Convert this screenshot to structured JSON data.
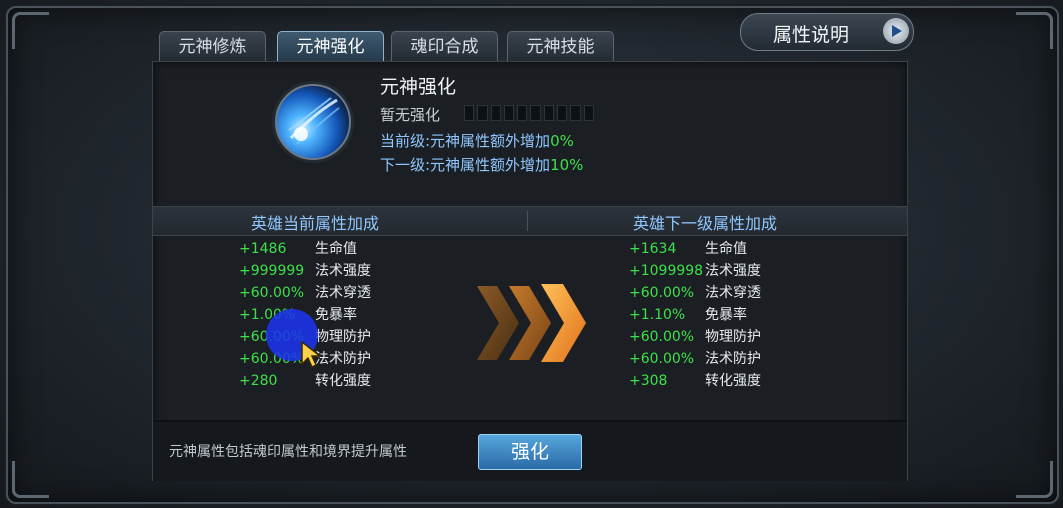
{
  "tabs": [
    {
      "label": "元神修炼",
      "active": false
    },
    {
      "label": "元神强化",
      "active": true
    },
    {
      "label": "魂印合成",
      "active": false
    },
    {
      "label": "元神技能",
      "active": false
    }
  ],
  "attr_button": {
    "label": "属性说明",
    "icon": "play-icon"
  },
  "panel": {
    "title": "元神强化",
    "status_text": "暂无强化",
    "progress": {
      "filled": 0,
      "total": 10
    },
    "current_level": {
      "label": "当前级:元神属性额外增加",
      "value": "0%"
    },
    "next_level": {
      "label": "下一级:元神属性额外增加",
      "value": "10%"
    }
  },
  "headers": {
    "current": "英雄当前属性加成",
    "next": "英雄下一级属性加成"
  },
  "current_stats": [
    {
      "value": "+1486",
      "name": "生命值"
    },
    {
      "value": "+999999",
      "name": "法术强度"
    },
    {
      "value": "+60.00%",
      "name": "法术穿透"
    },
    {
      "value": "+1.00%",
      "name": "免暴率"
    },
    {
      "value": "+60.00%",
      "name": "物理防护"
    },
    {
      "value": "+60.00%",
      "name": "法术防护"
    },
    {
      "value": "+280",
      "name": "转化强度"
    }
  ],
  "next_stats": [
    {
      "value": "+1634",
      "name": "生命值"
    },
    {
      "value": "+1099998",
      "name": "法术强度"
    },
    {
      "value": "+60.00%",
      "name": "法术穿透"
    },
    {
      "value": "+1.10%",
      "name": "免暴率"
    },
    {
      "value": "+60.00%",
      "name": "物理防护"
    },
    {
      "value": "+60.00%",
      "name": "法术防护"
    },
    {
      "value": "+308",
      "name": "转化强度"
    }
  ],
  "footer": {
    "note": "元神属性包括魂印属性和境界提升属性",
    "enhance_button": "强化"
  },
  "colors": {
    "accent_blue": "#8fc7ff",
    "value_green": "#3ee04a",
    "arrow_orange": "#f08a1e"
  }
}
